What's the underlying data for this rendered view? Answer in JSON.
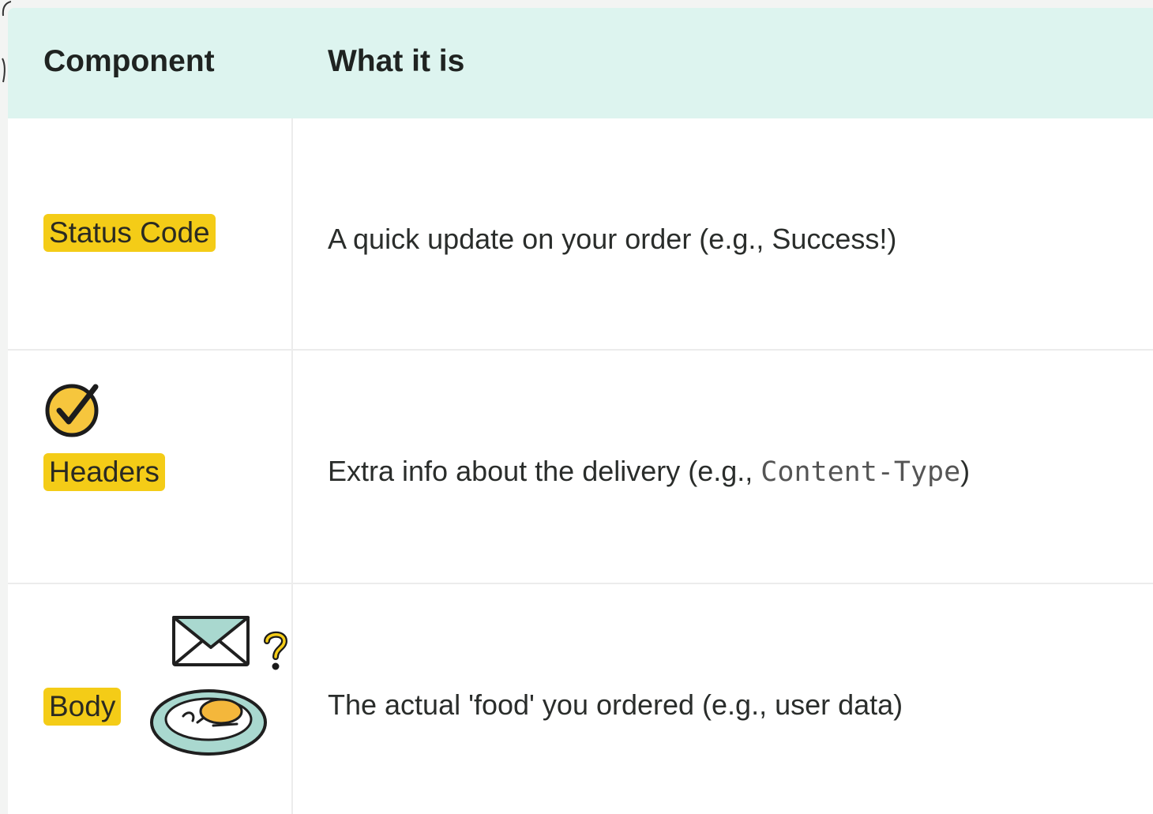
{
  "table": {
    "headers": {
      "component": "Component",
      "what_it_is": "What it is"
    },
    "rows": [
      {
        "component": "Status Code",
        "description": "A quick update on your order (e.g., Success!)"
      },
      {
        "component": "Headers",
        "description_prefix": "Extra info about the delivery (e.g., ",
        "description_code": "Content-Type",
        "description_suffix": ")"
      },
      {
        "component": "Body",
        "description": "The actual 'food' you ordered (e.g., user data)"
      }
    ]
  },
  "icons": {
    "headers_row": "checkmark-circle-icon",
    "body_row": [
      "envelope-icon",
      "question-mark-icon",
      "plate-of-food-icon"
    ]
  },
  "colors": {
    "header_background": "#ddf4ef",
    "highlight": "#f4cc17",
    "card_background": "#ffffff",
    "divider": "#ececec"
  }
}
